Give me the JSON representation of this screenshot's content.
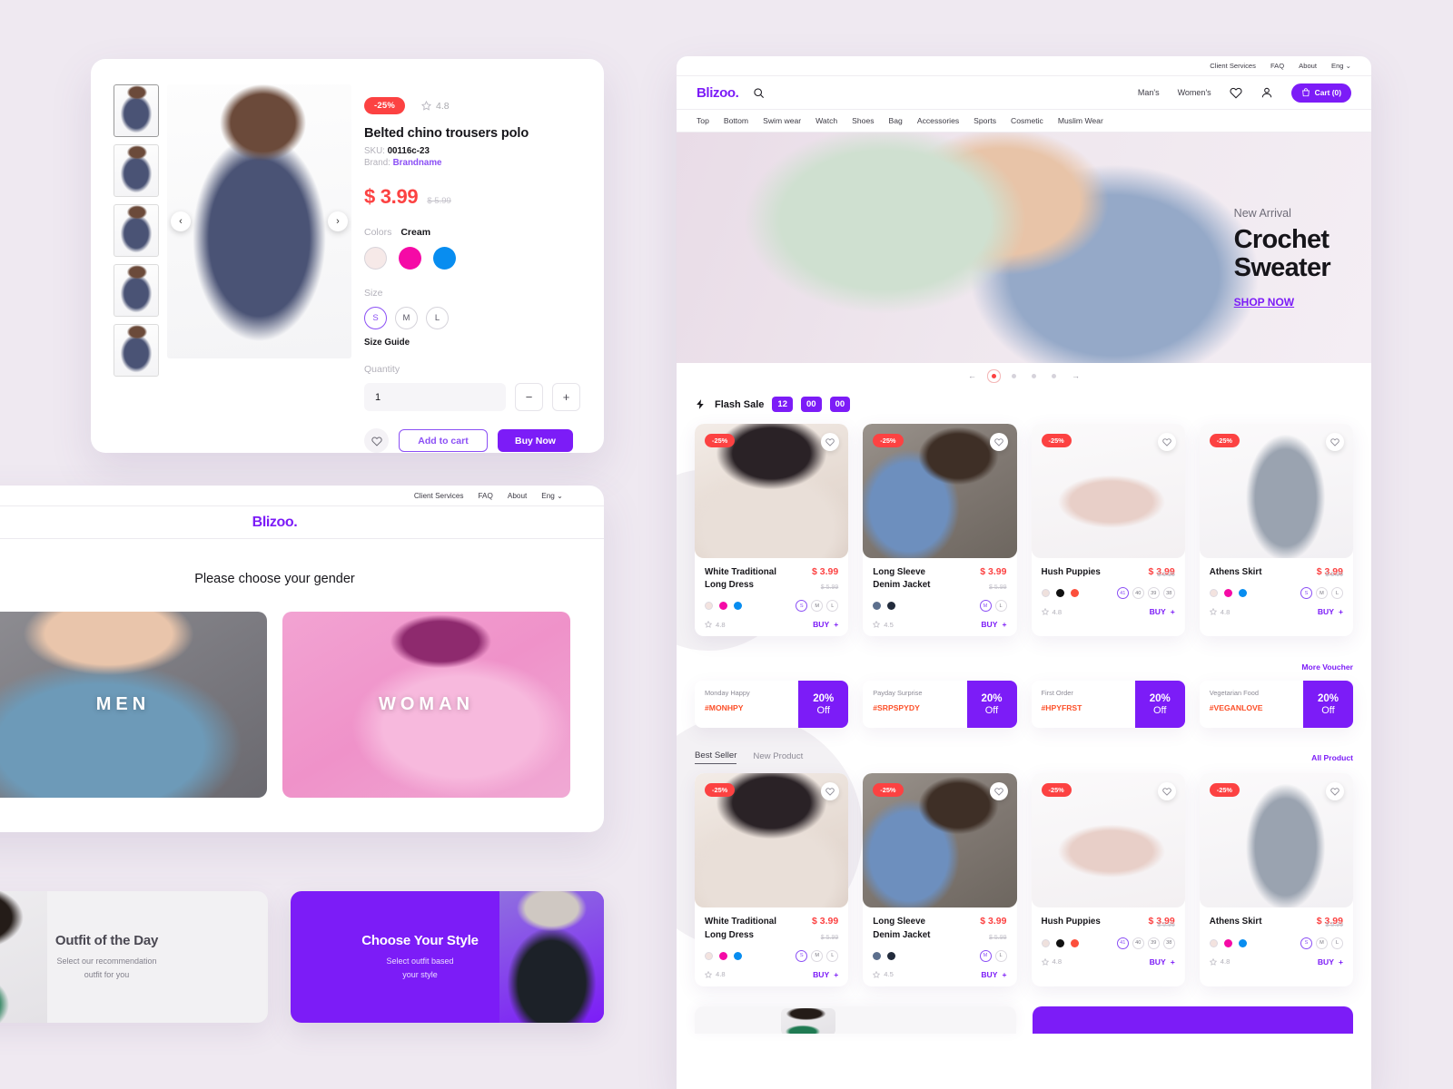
{
  "brand": {
    "name": "Blizoo."
  },
  "product_detail": {
    "discount_badge": "-25%",
    "rating": "4.8",
    "title": "Belted chino trousers polo",
    "sku_label": "SKU:",
    "sku_value": "00116c-23",
    "brand_label": "Brand:",
    "brand_value": "Brandname",
    "price": "$ 3.99",
    "price_old": "$ 5.99",
    "colors_label": "Colors",
    "color_selected": "Cream",
    "color_swatches": [
      "#f6e9e8",
      "#f50aa6",
      "#088df0"
    ],
    "size_label": "Size",
    "sizes": [
      "S",
      "M",
      "L"
    ],
    "size_selected": "S",
    "size_guide": "Size Guide",
    "quantity_label": "Quantity",
    "quantity_value": "1",
    "minus": "−",
    "plus": "+",
    "add_to_cart": "Add to cart",
    "buy_now": "Buy Now",
    "prev_arrow": "‹",
    "next_arrow": "›"
  },
  "gender_page": {
    "utility_links": [
      "Client Services",
      "FAQ",
      "About",
      "Eng ⌄"
    ],
    "heading": "Please choose your gender",
    "tiles": [
      {
        "label": "MEN"
      },
      {
        "label": "WOMAN"
      }
    ]
  },
  "promos": [
    {
      "title": "Outfit of the Day",
      "subtitle": "Select our recommendation\noutfit for you"
    },
    {
      "title": "Choose Your Style",
      "subtitle": "Select outfit based\nyour style"
    }
  ],
  "shop": {
    "utility_links": [
      "Client Services",
      "FAQ",
      "About",
      "Eng ⌄"
    ],
    "header_links": [
      "Man's",
      "Women's"
    ],
    "cart_label": "Cart (0)",
    "categories": [
      "Top",
      "Bottom",
      "Swim wear",
      "Watch",
      "Shoes",
      "Bag",
      "Accessories",
      "Sports",
      "Cosmetic",
      "Muslim Wear"
    ],
    "hero": {
      "eyebrow": "New Arrival",
      "title_line1": "Crochet",
      "title_line2": "Sweater",
      "cta": "SHOP NOW"
    },
    "carousel": {
      "prev": "←",
      "next": "→",
      "dot_count": 5,
      "active_index": 0
    },
    "flash_sale": {
      "label": "Flash Sale",
      "countdown": [
        "12",
        "00",
        "00"
      ]
    },
    "products": [
      {
        "name": "White Traditional Long Dress",
        "discount": "-25%",
        "price": "$ 3.99",
        "price_old": "$ 5.99",
        "rating": "4.8",
        "buy": "BUY",
        "colors": [
          "#f3e3df",
          "#f50aa6",
          "#088df0"
        ],
        "sizes": [
          "S",
          "M",
          "L"
        ],
        "size_selected": "S",
        "image": "ph-dress"
      },
      {
        "name": "Long Sleeve Denim Jacket",
        "discount": "-25%",
        "price": "$ 3.99",
        "price_old": "$ 5.99",
        "rating": "4.5",
        "buy": "BUY",
        "colors": [
          "#5c6f8d",
          "#222b3c"
        ],
        "sizes": [
          "M",
          "L"
        ],
        "size_selected": "M",
        "image": "ph-denim"
      },
      {
        "name": "Hush Puppies",
        "discount": "-25%",
        "price": "$ 3.99",
        "price_old": "$ 5.99",
        "rating": "4.8",
        "buy": "BUY",
        "colors": [
          "#efe1dd",
          "#111111",
          "#fc4f3c"
        ],
        "sizes": [
          "41",
          "40",
          "39",
          "38"
        ],
        "size_selected": "41",
        "image": "ph-shoe"
      },
      {
        "name": "Athens Skirt",
        "discount": "-25%",
        "price": "$ 3.99",
        "price_old": "$ 5.99",
        "rating": "4.8",
        "buy": "BUY",
        "colors": [
          "#f3e3df",
          "#f50aa6",
          "#088df0"
        ],
        "sizes": [
          "S",
          "M",
          "L"
        ],
        "size_selected": "S",
        "image": "ph-skirt"
      }
    ],
    "vouchers_more": "More Voucher",
    "vouchers": [
      {
        "title": "Monday Happy",
        "code": "#MONHPY",
        "pct": "20%",
        "off": "Off"
      },
      {
        "title": "Payday Surprise",
        "code": "#SRPSPYDY",
        "pct": "20%",
        "off": "Off"
      },
      {
        "title": "First Order",
        "code": "#HPYFRST",
        "pct": "20%",
        "off": "Off"
      },
      {
        "title": "Vegetarian Food",
        "code": "#VEGANLOVE",
        "pct": "20%",
        "off": "Off"
      }
    ],
    "tabs": [
      {
        "label": "Best Seller",
        "active": true
      },
      {
        "label": "New Product",
        "active": false
      }
    ],
    "all_product": "All Product"
  },
  "colors": {
    "accent": "#7c1cf7",
    "accent_light": "#8b4ff5",
    "red": "#fc4242",
    "page_bg": "#efe9f1",
    "code_orange": "#fc4f28"
  }
}
